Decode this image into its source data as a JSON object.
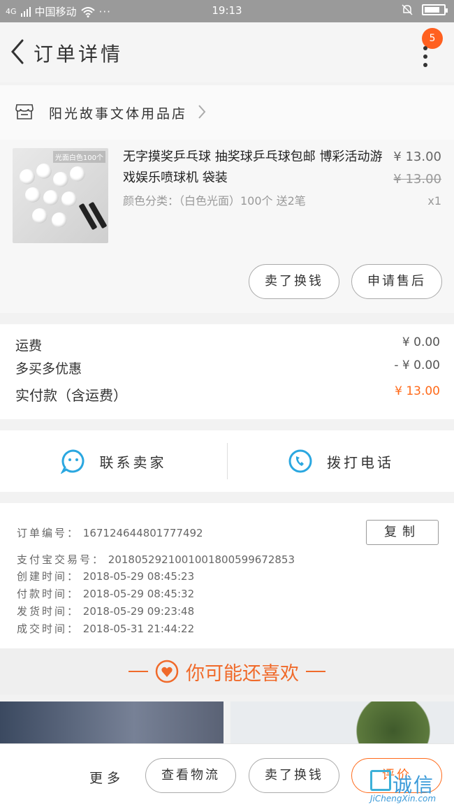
{
  "status_bar": {
    "carrier": "中国移动",
    "signal": "4G",
    "dots": "···",
    "time": "19:13"
  },
  "header": {
    "title": "订单详情",
    "badge_count": "5"
  },
  "shop": {
    "name": "阳光故事文体用品店"
  },
  "product": {
    "image_tag": "光面白色100个",
    "title": "无字摸奖乒乓球 抽奖球乒乓球包邮 博彩活动游戏娱乐喷球机 袋装",
    "spec": "颜色分类：（白色光面）100个 送2笔",
    "price": "¥ 13.00",
    "original_price": "¥ 13.00",
    "quantity": "x1",
    "buttons": {
      "sell_again": "卖了换钱",
      "after_sale": "申请售后"
    }
  },
  "fees": {
    "shipping_label": "运费",
    "shipping_value": "¥ 0.00",
    "discount_label": "多买多优惠",
    "discount_value": "- ¥ 0.00",
    "total_label": "实付款（含运费）",
    "total_value": "¥ 13.00"
  },
  "contact": {
    "seller_label": "联系卖家",
    "call_label": "拨打电话"
  },
  "order_info": {
    "order_no_label": "订单编号：",
    "order_no": "167124644801777492",
    "copy_label": "复制",
    "alipay_label": "支付宝交易号：",
    "alipay_no": "2018052921001001800599672853",
    "created_label": "创建时间：",
    "created": "2018-05-29 08:45:23",
    "paid_label": "付款时间：",
    "paid": "2018-05-29 08:45:32",
    "shipped_label": "发货时间：",
    "shipped": "2018-05-29 09:23:48",
    "completed_label": "成交时间：",
    "completed": "2018-05-31 21:44:22"
  },
  "recommend": {
    "title": "你可能还喜欢"
  },
  "bottom_bar": {
    "more": "更多",
    "logistics": "查看物流",
    "sell_again": "卖了换钱",
    "review": "评价"
  },
  "watermark": {
    "logo_text": "诚信",
    "url": "JiChengXin.com"
  },
  "colors": {
    "accent": "#ff6a1a",
    "badge": "#ff6020",
    "contact_icon": "#2aa7e0"
  },
  "battery_level": 0.8
}
